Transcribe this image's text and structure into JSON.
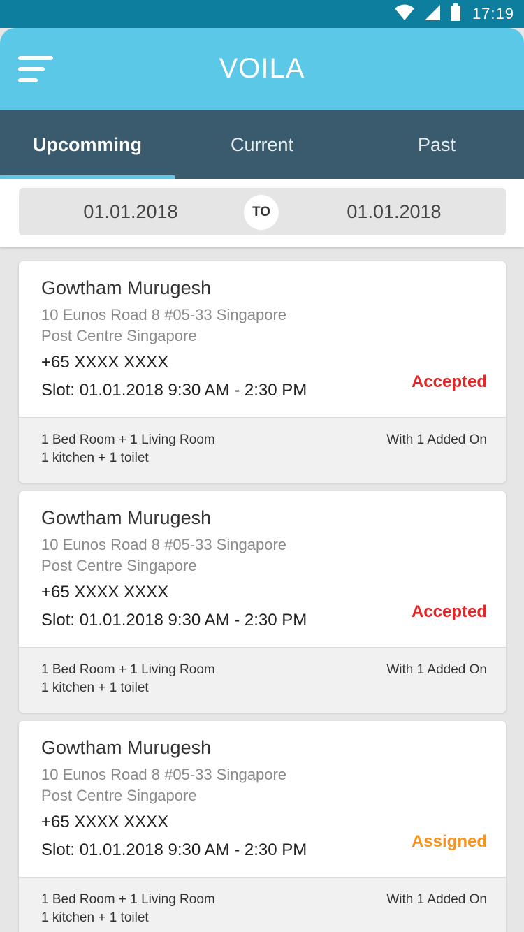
{
  "status_bar": {
    "time": "17:19",
    "icons": [
      "wifi-icon",
      "signal-icon",
      "battery-icon"
    ]
  },
  "app_bar": {
    "title": "VOILA",
    "menu_icon": "hamburger-menu-icon"
  },
  "tabs": [
    {
      "label": "Upcomming",
      "active": true
    },
    {
      "label": "Current",
      "active": false
    },
    {
      "label": "Past",
      "active": false
    }
  ],
  "date_range": {
    "from": "01.01.2018",
    "separator": "TO",
    "to": "01.01.2018"
  },
  "bookings": [
    {
      "name": "Gowtham Murugesh",
      "address_line1": "10 Eunos Road 8 #05-33 Singapore",
      "address_line2": "Post Centre Singapore",
      "phone": "+65 XXXX XXXX",
      "slot": "Slot: 01.01.2018 9:30 AM - 2:30 PM",
      "status": "Accepted",
      "rooms_line1": "1 Bed Room + 1 Living Room",
      "rooms_line2": "1 kitchen + 1 toilet",
      "addon": "With 1 Added On"
    },
    {
      "name": "Gowtham Murugesh",
      "address_line1": "10 Eunos Road 8 #05-33 Singapore",
      "address_line2": "Post Centre Singapore",
      "phone": "+65 XXXX XXXX",
      "slot": "Slot: 01.01.2018 9:30 AM - 2:30 PM",
      "status": "Accepted",
      "rooms_line1": "1 Bed Room + 1 Living Room",
      "rooms_line2": "1 kitchen + 1 toilet",
      "addon": "With 1 Added On"
    },
    {
      "name": "Gowtham Murugesh",
      "address_line1": "10 Eunos Road 8 #05-33 Singapore",
      "address_line2": "Post Centre Singapore",
      "phone": "+65 XXXX XXXX",
      "slot": "Slot: 01.01.2018 9:30 AM - 2:30 PM",
      "status": "Assigned",
      "rooms_line1": "1 Bed Room + 1 Living Room",
      "rooms_line2": "1 kitchen + 1 toilet",
      "addon": "With 1 Added On"
    }
  ],
  "colors": {
    "status_bar": "#0d7e9d",
    "app_bar": "#5bc8e8",
    "tab_bar": "#3a5a6d",
    "accepted": "#e32525",
    "assigned": "#f7931e"
  }
}
